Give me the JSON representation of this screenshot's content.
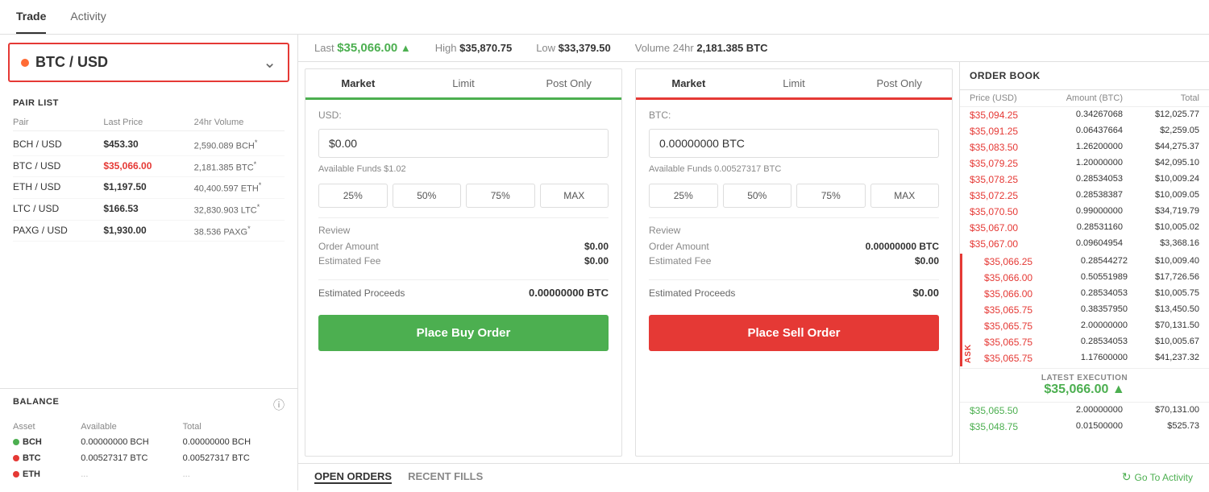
{
  "nav": {
    "items": [
      {
        "label": "Trade",
        "active": true
      },
      {
        "label": "Activity",
        "active": false
      }
    ]
  },
  "pair_selector": {
    "symbol": "BTC / USD",
    "dot_color": "#ff6b35"
  },
  "market_info": {
    "last_label": "Last",
    "last_price": "$35,066.00",
    "high_label": "High",
    "high_price": "$35,870.75",
    "low_label": "Low",
    "low_price": "$33,379.50",
    "volume_label": "Volume 24hr",
    "volume_value": "2,181.385 BTC"
  },
  "pair_list": {
    "title": "PAIR LIST",
    "headers": [
      "Pair",
      "Last Price",
      "24hr Volume"
    ],
    "rows": [
      {
        "pair": "BCH / USD",
        "last_price": "$453.30",
        "volume": "2,590.089 BCH",
        "active": false
      },
      {
        "pair": "BTC / USD",
        "last_price": "$35,066.00",
        "volume": "2,181.385 BTC",
        "active": true
      },
      {
        "pair": "ETH / USD",
        "last_price": "$1,197.50",
        "volume": "40,400.597 ETH",
        "active": false
      },
      {
        "pair": "LTC / USD",
        "last_price": "$166.53",
        "volume": "32,830.903 LTC",
        "active": false
      },
      {
        "pair": "PAXG / USD",
        "last_price": "$1,930.00",
        "volume": "38.536 PAXG",
        "active": false
      }
    ]
  },
  "balance": {
    "title": "BALANCE",
    "headers": [
      "Asset",
      "Available",
      "Total"
    ],
    "rows": [
      {
        "asset": "BCH",
        "color": "green",
        "available": "0.00000000 BCH",
        "total": "0.00000000 BCH"
      },
      {
        "asset": "BTC",
        "color": "red",
        "available": "0.00527317 BTC",
        "total": "0.00527317 BTC"
      },
      {
        "asset": "ETH",
        "color": "red",
        "available": "...",
        "total": "..."
      }
    ]
  },
  "buy_panel": {
    "tabs": [
      "Market",
      "Limit",
      "Post Only"
    ],
    "active_tab": "Market",
    "currency_label": "USD:",
    "input_value": "$0.00",
    "available_funds": "Available Funds $1.02",
    "percent_buttons": [
      "25%",
      "50%",
      "75%",
      "MAX"
    ],
    "review_title": "Review",
    "order_amount_label": "Order Amount",
    "order_amount_value": "$0.00",
    "estimated_fee_label": "Estimated Fee",
    "estimated_fee_value": "$0.00",
    "estimated_proceeds_label": "Estimated Proceeds",
    "estimated_proceeds_value": "0.00000000 BTC",
    "button_label": "Place Buy Order"
  },
  "sell_panel": {
    "tabs": [
      "Market",
      "Limit",
      "Post Only"
    ],
    "active_tab": "Market",
    "currency_label": "BTC:",
    "input_value": "0.00000000 BTC",
    "available_funds": "Available Funds 0.00527317 BTC",
    "percent_buttons": [
      "25%",
      "50%",
      "75%",
      "MAX"
    ],
    "review_title": "Review",
    "order_amount_label": "Order Amount",
    "order_amount_value": "0.00000000 BTC",
    "estimated_fee_label": "Estimated Fee",
    "estimated_fee_value": "$0.00",
    "estimated_proceeds_label": "Estimated Proceeds",
    "estimated_proceeds_value": "$0.00",
    "button_label": "Place Sell Order"
  },
  "order_book": {
    "title": "ORDER BOOK",
    "headers": [
      "Price (USD)",
      "Amount (BTC)",
      "Total"
    ],
    "ask_label": "ASK",
    "ask_rows": [
      {
        "price": "$35,094.25",
        "amount": "0.34267068",
        "total": "$12,025.77"
      },
      {
        "price": "$35,091.25",
        "amount": "0.06437664",
        "total": "$2,259.05"
      },
      {
        "price": "$35,083.50",
        "amount": "1.26200000",
        "total": "$44,275.37"
      },
      {
        "price": "$35,079.25",
        "amount": "1.20000000",
        "total": "$42,095.10"
      },
      {
        "price": "$35,078.25",
        "amount": "0.28534053",
        "total": "$10,009.24"
      },
      {
        "price": "$35,072.25",
        "amount": "0.28538387",
        "total": "$10,009.05"
      },
      {
        "price": "$35,070.50",
        "amount": "0.99000000",
        "total": "$34,719.79"
      },
      {
        "price": "$35,067.00",
        "amount": "0.28531160",
        "total": "$10,005.02"
      },
      {
        "price": "$35,067.00",
        "amount": "0.09604954",
        "total": "$3,368.16"
      },
      {
        "price": "$35,066.25",
        "amount": "0.28544272",
        "total": "$10,009.40"
      },
      {
        "price": "$35,066.00",
        "amount": "0.50551989",
        "total": "$17,726.56"
      },
      {
        "price": "$35,066.00",
        "amount": "0.28534053",
        "total": "$10,005.75"
      },
      {
        "price": "$35,065.75",
        "amount": "0.38357950",
        "total": "$13,450.50"
      },
      {
        "price": "$35,065.75",
        "amount": "2.00000000",
        "total": "$70,131.50"
      },
      {
        "price": "$35,065.75",
        "amount": "0.28534053",
        "total": "$10,005.67"
      },
      {
        "price": "$35,065.75",
        "amount": "1.17600000",
        "total": "$41,237.32"
      }
    ],
    "latest_execution_label": "LATEST EXECUTION",
    "latest_execution_price": "$35,066.00",
    "bid_rows": [
      {
        "price": "$35,065.50",
        "amount": "2.00000000",
        "total": "$70,131.00"
      },
      {
        "price": "$35,048.75",
        "amount": "0.01500000",
        "total": "$525.73"
      }
    ]
  },
  "bottom": {
    "open_orders_label": "OPEN ORDERS",
    "recent_fills_label": "RECENT FILLS",
    "go_to_activity_label": "Go To Activity"
  }
}
